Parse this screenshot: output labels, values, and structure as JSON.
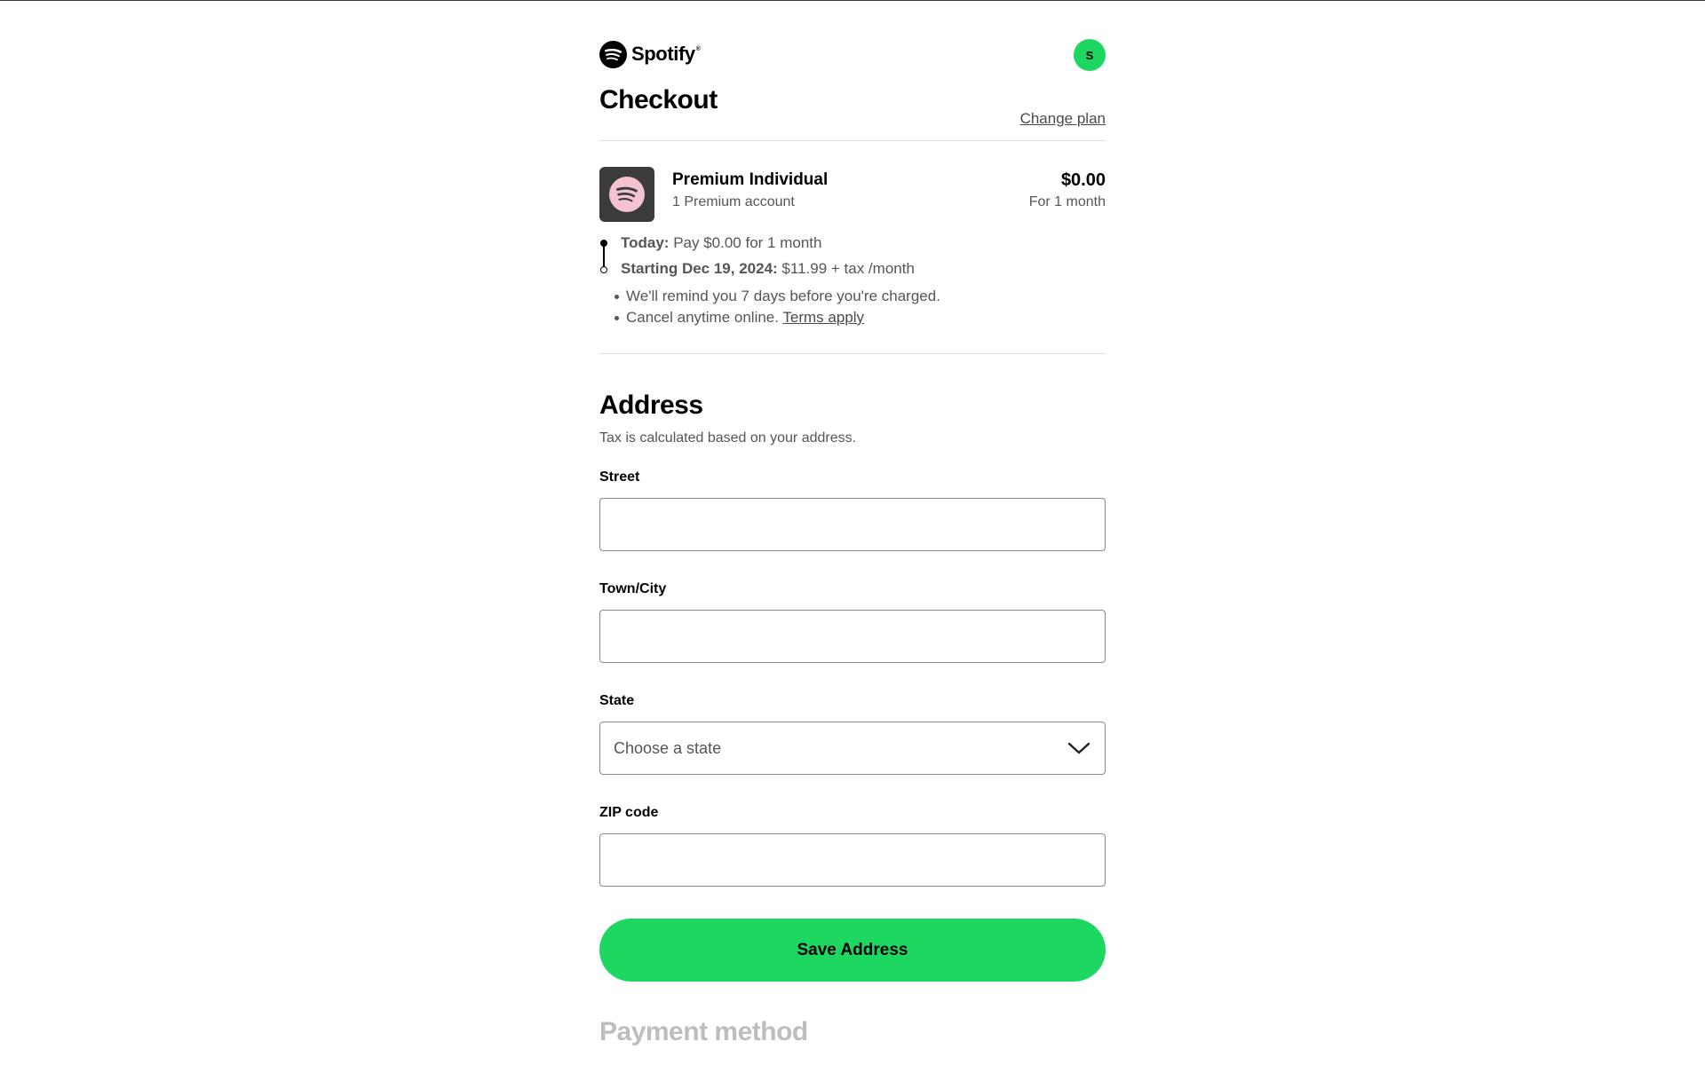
{
  "header": {
    "brand": "Spotify",
    "brand_mark": "®",
    "avatar_initial": "S"
  },
  "checkout": {
    "title": "Checkout",
    "change_plan": "Change plan"
  },
  "plan": {
    "name": "Premium Individual",
    "accounts": "1 Premium account",
    "price": "$0.00",
    "period": "For 1 month"
  },
  "timeline": {
    "today_label": "Today:",
    "today_text": " Pay $0.00 for 1 month",
    "start_label": "Starting Dec 19, 2024:",
    "start_text": " $11.99 + tax /month"
  },
  "notes": {
    "remind": "We'll remind you 7 days before you're charged.",
    "cancel": "Cancel anytime online. ",
    "terms": "Terms apply"
  },
  "address": {
    "title": "Address",
    "subtitle": "Tax is calculated based on your address.",
    "street_label": "Street",
    "street_value": "",
    "city_label": "Town/City",
    "city_value": "",
    "state_label": "State",
    "state_value": "Choose a state",
    "zip_label": "ZIP code",
    "zip_value": "",
    "save_button": "Save Address"
  },
  "payment": {
    "title": "Payment method"
  },
  "colors": {
    "accent": "#1ed760",
    "text_muted": "#555555",
    "disabled_heading": "#bdbdbd"
  }
}
